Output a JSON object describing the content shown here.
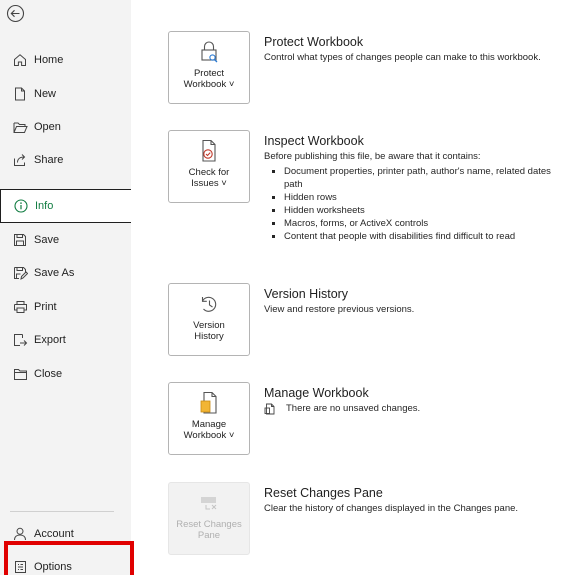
{
  "sidebar": {
    "items": [
      {
        "id": "home",
        "label": "Home",
        "icon": "home-icon"
      },
      {
        "id": "new",
        "label": "New",
        "icon": "new-document-icon"
      },
      {
        "id": "open",
        "label": "Open",
        "icon": "folder-open-icon"
      },
      {
        "id": "share",
        "label": "Share",
        "icon": "share-icon"
      },
      {
        "id": "info",
        "label": "Info",
        "icon": "info-icon",
        "selected": true
      },
      {
        "id": "save",
        "label": "Save",
        "icon": "save-icon"
      },
      {
        "id": "save-as",
        "label": "Save As",
        "icon": "save-as-icon"
      },
      {
        "id": "print",
        "label": "Print",
        "icon": "printer-icon"
      },
      {
        "id": "export",
        "label": "Export",
        "icon": "export-icon"
      },
      {
        "id": "close",
        "label": "Close",
        "icon": "close-folder-icon"
      }
    ],
    "bottom": [
      {
        "id": "account",
        "label": "Account",
        "icon": "person-icon"
      },
      {
        "id": "options",
        "label": "Options",
        "icon": "options-icon"
      }
    ]
  },
  "sections": {
    "protect": {
      "tile_line1": "Protect",
      "tile_line2": "Workbook ˅",
      "title": "Protect Workbook",
      "desc": "Control what types of changes people can make to this workbook."
    },
    "inspect": {
      "tile_line1": "Check for",
      "tile_line2": "Issues ˅",
      "title": "Inspect Workbook",
      "desc": "Before publishing this file, be aware that it contains:",
      "bullets": [
        "Document properties, printer path, author's name, related dates path",
        "Hidden rows",
        "Hidden worksheets",
        "Macros, forms, or ActiveX controls",
        "Content that people with disabilities find difficult to read"
      ]
    },
    "version": {
      "tile_line1": "Version",
      "tile_line2": "History",
      "title": "Version History",
      "desc": "View and restore previous versions."
    },
    "manage": {
      "tile_line1": "Manage",
      "tile_line2": "Workbook ˅",
      "title": "Manage Workbook",
      "desc": "There are no unsaved changes."
    },
    "reset": {
      "tile_line1": "Reset Changes",
      "tile_line2": "Pane",
      "title": "Reset Changes Pane",
      "desc": "Clear the history of changes displayed in the Changes pane."
    }
  },
  "colors": {
    "accent": "#107c41",
    "highlight": "#e00000",
    "sidebar_bg": "#f3f3f3"
  }
}
